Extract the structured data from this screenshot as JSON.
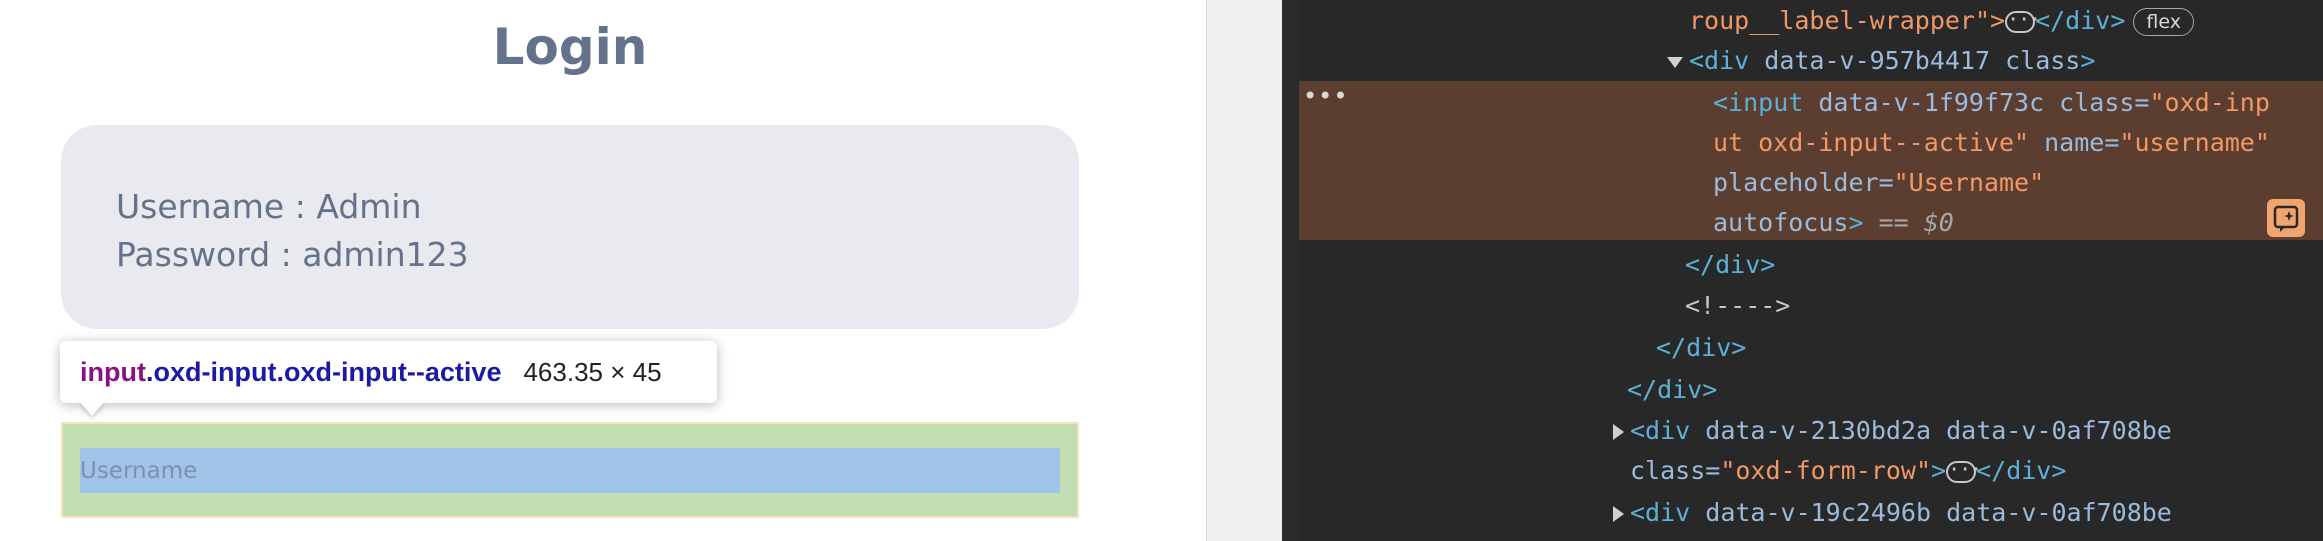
{
  "page": {
    "title": "Login",
    "credentials": {
      "username_line": "Username : Admin",
      "password_line": "Password : admin123"
    },
    "username_field": {
      "placeholder": "Username",
      "value": ""
    }
  },
  "inspector_tooltip": {
    "tag": "input",
    "classes": ".oxd-input.oxd-input--active",
    "dimensions": "463.35 × 45"
  },
  "devtools": {
    "line1": {
      "text": "roup__label-wrapper\">",
      "close": "</div>",
      "badge": "flex"
    },
    "line2": {
      "open": "<div ",
      "attrs": "data-v-957b4417 class",
      "close": ">"
    },
    "selected": {
      "l1_open": "<input ",
      "l1_attr": "data-v-1f99f73c class=",
      "l1_val": "\"oxd-inp",
      "l2_val": "ut oxd-input--active\"",
      "l2_attr": " name=",
      "l2_val2": "\"username\"",
      "l3_attr": "placeholder=",
      "l3_val": "\"Username\"",
      "l4_attr": "autofocus",
      "l4_close": ">",
      "l4_eq": " == $0"
    },
    "line_close_div_1": "</div>",
    "line_comment": "<!---->",
    "line_close_div_2": "</div>",
    "line_close_div_3": "</div>",
    "row1": {
      "open": "<div ",
      "attrs": "data-v-2130bd2a data-v-0af708be"
    },
    "row1b": {
      "attr": "class=",
      "val": "\"oxd-form-row\"",
      "close": ">",
      "end": "</div>"
    },
    "row2": {
      "open": "<div ",
      "attrs": "data-v-19c2496b data-v-0af708be"
    },
    "gutter": "•••"
  },
  "colors": {
    "title": "#64728c",
    "credentials_bg": "#e8eaef",
    "devtools_bg": "#282828",
    "selected_row": "#5c3e31",
    "tag": "#5db0d7",
    "value": "#f29766"
  },
  "icons": [
    "caret-down-icon",
    "caret-right-icon",
    "ellipsis-icon",
    "ai-assistant-icon"
  ]
}
